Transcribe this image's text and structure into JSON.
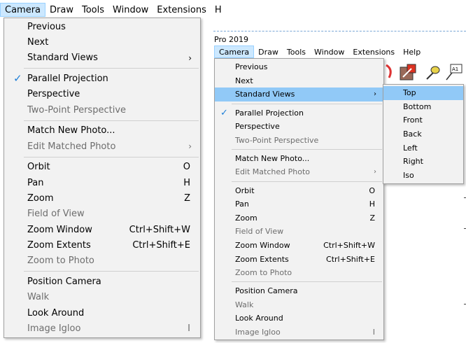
{
  "left": {
    "menubar": [
      {
        "label": "Camera",
        "active": true
      },
      {
        "label": "Draw"
      },
      {
        "label": "Tools"
      },
      {
        "label": "Window"
      },
      {
        "label": "Extensions"
      },
      {
        "label": "H"
      }
    ],
    "menu": [
      {
        "label": "Previous"
      },
      {
        "label": "Next"
      },
      {
        "label": "Standard Views",
        "submenu": true
      },
      {
        "sep": true
      },
      {
        "label": "Parallel Projection",
        "checked": true
      },
      {
        "label": "Perspective"
      },
      {
        "label": "Two-Point Perspective",
        "disabled": true
      },
      {
        "sep": true
      },
      {
        "label": "Match New Photo..."
      },
      {
        "label": "Edit Matched Photo",
        "disabled": true,
        "submenu": true
      },
      {
        "sep": true
      },
      {
        "label": "Orbit",
        "shortcut": "O"
      },
      {
        "label": "Pan",
        "shortcut": "H"
      },
      {
        "label": "Zoom",
        "shortcut": "Z"
      },
      {
        "label": "Field of View",
        "disabled": true
      },
      {
        "label": "Zoom Window",
        "shortcut": "Ctrl+Shift+W"
      },
      {
        "label": "Zoom Extents",
        "shortcut": "Ctrl+Shift+E"
      },
      {
        "label": "Zoom to Photo",
        "disabled": true
      },
      {
        "sep": true
      },
      {
        "label": "Position Camera"
      },
      {
        "label": "Walk",
        "disabled": true
      },
      {
        "label": "Look Around"
      },
      {
        "label": "Image Igloo",
        "disabled": true,
        "shortcut": "I"
      }
    ]
  },
  "right": {
    "title": "Pro 2019",
    "menubar": [
      {
        "label": "Camera",
        "active": true
      },
      {
        "label": "Draw"
      },
      {
        "label": "Tools"
      },
      {
        "label": "Window"
      },
      {
        "label": "Extensions"
      },
      {
        "label": "Help"
      }
    ],
    "menu": [
      {
        "label": "Previous"
      },
      {
        "label": "Next"
      },
      {
        "label": "Standard Views",
        "submenu": true,
        "highlight": true
      },
      {
        "sep": true
      },
      {
        "label": "Parallel Projection",
        "checked": true
      },
      {
        "label": "Perspective"
      },
      {
        "label": "Two-Point Perspective",
        "disabled": true
      },
      {
        "sep": true
      },
      {
        "label": "Match New Photo..."
      },
      {
        "label": "Edit Matched Photo",
        "disabled": true,
        "submenu": true
      },
      {
        "sep": true
      },
      {
        "label": "Orbit",
        "shortcut": "O"
      },
      {
        "label": "Pan",
        "shortcut": "H"
      },
      {
        "label": "Zoom",
        "shortcut": "Z"
      },
      {
        "label": "Field of View",
        "disabled": true
      },
      {
        "label": "Zoom Window",
        "shortcut": "Ctrl+Shift+W"
      },
      {
        "label": "Zoom Extents",
        "shortcut": "Ctrl+Shift+E"
      },
      {
        "label": "Zoom to Photo",
        "disabled": true
      },
      {
        "sep": true
      },
      {
        "label": "Position Camera"
      },
      {
        "label": "Walk",
        "disabled": true
      },
      {
        "label": "Look Around"
      },
      {
        "label": "Image Igloo",
        "disabled": true,
        "shortcut": "I"
      }
    ],
    "submenu": [
      {
        "label": "Top",
        "selected": true
      },
      {
        "label": "Bottom"
      },
      {
        "label": "Front"
      },
      {
        "label": "Back"
      },
      {
        "label": "Left"
      },
      {
        "label": "Right"
      },
      {
        "label": "Iso"
      }
    ],
    "toolbar_icons": [
      "follow-me-icon",
      "scale-icon",
      "tape-measure-icon",
      "text-label-icon"
    ],
    "toolbar_text_icon_label": "A1"
  },
  "colors": {
    "menu_bg": "#f2f2f2",
    "highlight": "#91c9f7",
    "active_menubar": "#cce8ff",
    "disabled_text": "#6d6d6d",
    "check": "#1e7fd8"
  }
}
